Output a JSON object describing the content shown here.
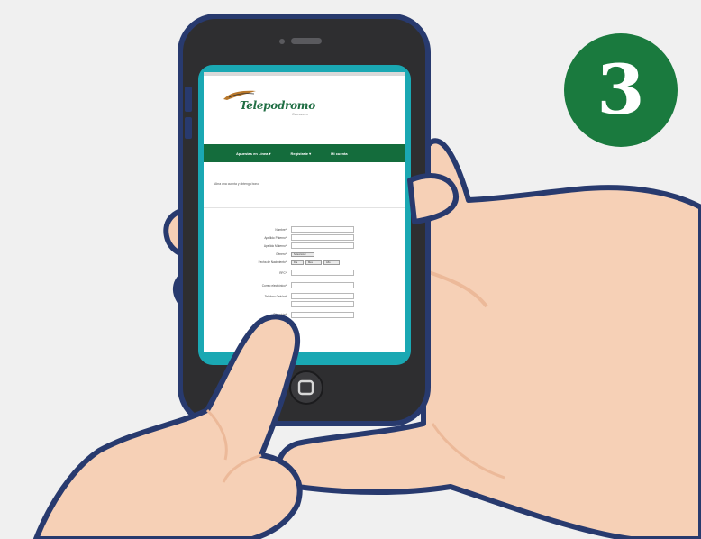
{
  "screen": {
    "logo": "Telepodromo",
    "logo_sub": "Camarero",
    "nav": [
      "Apuestas en Línea ▾",
      "Regístrate ▾",
      "Mi cuenta"
    ],
    "subtitle": "Abra una cuenta y obtenga bono",
    "form_fields": [
      {
        "label": "Nombre*",
        "type": "input"
      },
      {
        "label": "Apellido Paterno*",
        "type": "input"
      },
      {
        "label": "Apellido Materno*",
        "type": "input"
      },
      {
        "label": "Género*",
        "type": "select",
        "value": "Seleccionar"
      },
      {
        "label": "Fecha de Nacimiento*",
        "type": "date",
        "values": [
          "Día",
          "Mes",
          "Año"
        ]
      },
      {
        "label": "RFC*",
        "type": "input"
      },
      {
        "label": "Correo electrónico*",
        "type": "input"
      },
      {
        "label": "Teléfono Celular*",
        "type": "input"
      },
      {
        "label": "",
        "type": "input"
      },
      {
        "label": "Dirección*",
        "type": "input"
      }
    ]
  },
  "step_badge": {
    "number": "3",
    "color": "#1a7a3e"
  },
  "colors": {
    "background": "#f0f0f0",
    "phone_body": "#2e2e30",
    "phone_outline": "#283a6e",
    "screen_border": "#1aa8b3",
    "skin": "#f6d0b6",
    "skin_shade": "#ecb999",
    "nav_green": "#146c3c"
  }
}
